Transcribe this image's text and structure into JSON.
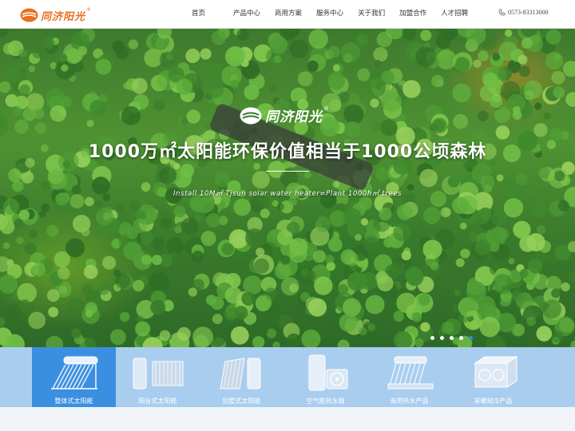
{
  "header": {
    "logo_text": "同济阳光",
    "logo_reg": "®",
    "nav": [
      "首页",
      "产品中心",
      "商用方案",
      "服务中心",
      "关于我们",
      "加盟合作",
      "人才招聘"
    ],
    "phone": "0573-83313000"
  },
  "banner": {
    "logo_text": "同济阳光",
    "logo_reg": "®",
    "headline": "1000万㎡太阳能环保价值相当于1000公顷森林",
    "subline": "Install 10M㎡ Tjsun solar water heater=Plant 1000h㎡ trees",
    "slides_total": 5,
    "active_slide": 5
  },
  "products": {
    "active_index": 0,
    "items": [
      {
        "label": "整体式太阳能",
        "icon": "integrated-solar-heater-icon"
      },
      {
        "label": "阳台式太阳能",
        "icon": "balcony-solar-heater-icon"
      },
      {
        "label": "别墅式太阳能",
        "icon": "villa-solar-heater-icon"
      },
      {
        "label": "空气能热水器",
        "icon": "air-source-heater-icon"
      },
      {
        "label": "商用热水产品",
        "icon": "commercial-hot-water-icon"
      },
      {
        "label": "采暖制冷产品",
        "icon": "heating-cooling-unit-icon"
      }
    ]
  },
  "colors": {
    "brand_orange": "#e8701e",
    "active_blue": "#3a8fe0",
    "tab_bar_blue": "#a9cdef"
  }
}
